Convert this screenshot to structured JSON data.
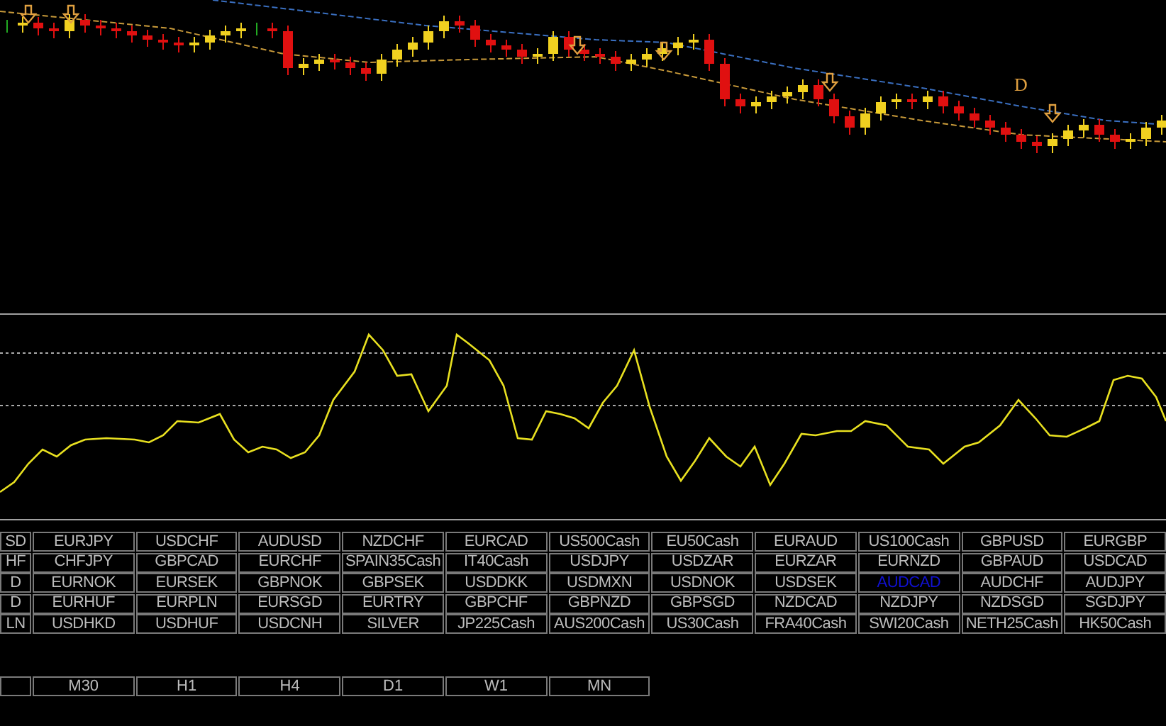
{
  "chart": {
    "marker_label": "D"
  },
  "symbol_grid": {
    "rows": [
      [
        {
          "label": "SD",
          "selected": false
        },
        {
          "label": "EURJPY",
          "selected": false
        },
        {
          "label": "USDCHF",
          "selected": false
        },
        {
          "label": "AUDUSD",
          "selected": false
        },
        {
          "label": "NZDCHF",
          "selected": false
        },
        {
          "label": "EURCAD",
          "selected": false
        },
        {
          "label": "US500Cash",
          "selected": false
        },
        {
          "label": "EU50Cash",
          "selected": false
        },
        {
          "label": "EURAUD",
          "selected": false
        },
        {
          "label": "US100Cash",
          "selected": false
        },
        {
          "label": "GBPUSD",
          "selected": false
        },
        {
          "label": "EURGBP",
          "selected": false
        }
      ],
      [
        {
          "label": "HF",
          "selected": false
        },
        {
          "label": "CHFJPY",
          "selected": false
        },
        {
          "label": "GBPCAD",
          "selected": false
        },
        {
          "label": "EURCHF",
          "selected": false
        },
        {
          "label": "SPAIN35Cash",
          "selected": false
        },
        {
          "label": "IT40Cash",
          "selected": false
        },
        {
          "label": "USDJPY",
          "selected": false
        },
        {
          "label": "USDZAR",
          "selected": false
        },
        {
          "label": "EURZAR",
          "selected": false
        },
        {
          "label": "EURNZD",
          "selected": false
        },
        {
          "label": "GBPAUD",
          "selected": false
        },
        {
          "label": "USDCAD",
          "selected": false
        }
      ],
      [
        {
          "label": "D",
          "selected": false
        },
        {
          "label": "EURNOK",
          "selected": false
        },
        {
          "label": "EURSEK",
          "selected": false
        },
        {
          "label": "GBPNOK",
          "selected": false
        },
        {
          "label": "GBPSEK",
          "selected": false
        },
        {
          "label": "USDDKK",
          "selected": false
        },
        {
          "label": "USDMXN",
          "selected": false
        },
        {
          "label": "USDNOK",
          "selected": false
        },
        {
          "label": "USDSEK",
          "selected": false
        },
        {
          "label": "AUDCAD",
          "selected": true
        },
        {
          "label": "AUDCHF",
          "selected": false
        },
        {
          "label": "AUDJPY",
          "selected": false
        }
      ],
      [
        {
          "label": "D",
          "selected": false
        },
        {
          "label": "EURHUF",
          "selected": false
        },
        {
          "label": "EURPLN",
          "selected": false
        },
        {
          "label": "EURSGD",
          "selected": false
        },
        {
          "label": "EURTRY",
          "selected": false
        },
        {
          "label": "GBPCHF",
          "selected": false
        },
        {
          "label": "GBPNZD",
          "selected": false
        },
        {
          "label": "GBPSGD",
          "selected": false
        },
        {
          "label": "NZDCAD",
          "selected": false
        },
        {
          "label": "NZDJPY",
          "selected": false
        },
        {
          "label": "NZDSGD",
          "selected": false
        },
        {
          "label": "SGDJPY",
          "selected": false
        }
      ],
      [
        {
          "label": "LN",
          "selected": false
        },
        {
          "label": "USDHKD",
          "selected": false
        },
        {
          "label": "USDHUF",
          "selected": false
        },
        {
          "label": "USDCNH",
          "selected": false
        },
        {
          "label": "SILVER",
          "selected": false
        },
        {
          "label": "JP225Cash",
          "selected": false
        },
        {
          "label": "AUS200Cash",
          "selected": false
        },
        {
          "label": "US30Cash",
          "selected": false
        },
        {
          "label": "FRA40Cash",
          "selected": false
        },
        {
          "label": "SWI20Cash",
          "selected": false
        },
        {
          "label": "NETH25Cash",
          "selected": false
        },
        {
          "label": "HK50Cash",
          "selected": false
        }
      ]
    ]
  },
  "timeframes": [
    {
      "label": "M30"
    },
    {
      "label": "H1"
    },
    {
      "label": "H4"
    },
    {
      "label": "D1"
    },
    {
      "label": "W1"
    },
    {
      "label": "MN"
    }
  ]
}
